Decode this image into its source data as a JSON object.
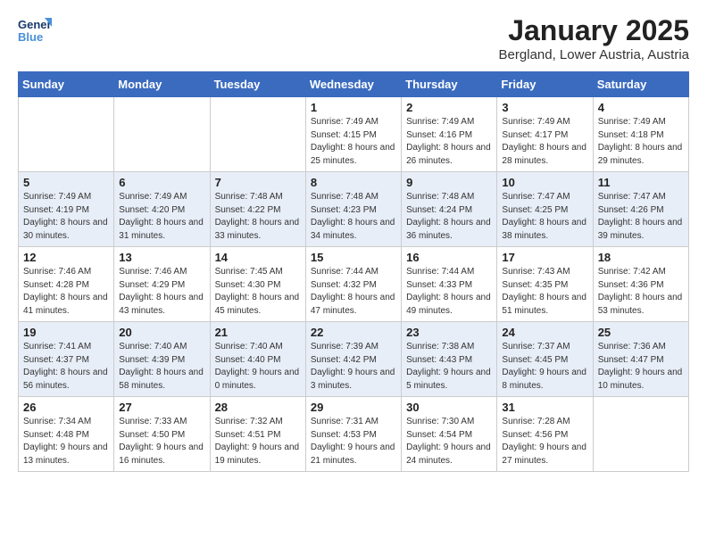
{
  "header": {
    "logo_line1": "General",
    "logo_line2": "Blue",
    "month": "January 2025",
    "location": "Bergland, Lower Austria, Austria"
  },
  "weekdays": [
    "Sunday",
    "Monday",
    "Tuesday",
    "Wednesday",
    "Thursday",
    "Friday",
    "Saturday"
  ],
  "weeks": [
    [
      {
        "day": "",
        "sunrise": "",
        "sunset": "",
        "daylight": ""
      },
      {
        "day": "",
        "sunrise": "",
        "sunset": "",
        "daylight": ""
      },
      {
        "day": "",
        "sunrise": "",
        "sunset": "",
        "daylight": ""
      },
      {
        "day": "1",
        "sunrise": "Sunrise: 7:49 AM",
        "sunset": "Sunset: 4:15 PM",
        "daylight": "Daylight: 8 hours and 25 minutes."
      },
      {
        "day": "2",
        "sunrise": "Sunrise: 7:49 AM",
        "sunset": "Sunset: 4:16 PM",
        "daylight": "Daylight: 8 hours and 26 minutes."
      },
      {
        "day": "3",
        "sunrise": "Sunrise: 7:49 AM",
        "sunset": "Sunset: 4:17 PM",
        "daylight": "Daylight: 8 hours and 28 minutes."
      },
      {
        "day": "4",
        "sunrise": "Sunrise: 7:49 AM",
        "sunset": "Sunset: 4:18 PM",
        "daylight": "Daylight: 8 hours and 29 minutes."
      }
    ],
    [
      {
        "day": "5",
        "sunrise": "Sunrise: 7:49 AM",
        "sunset": "Sunset: 4:19 PM",
        "daylight": "Daylight: 8 hours and 30 minutes."
      },
      {
        "day": "6",
        "sunrise": "Sunrise: 7:49 AM",
        "sunset": "Sunset: 4:20 PM",
        "daylight": "Daylight: 8 hours and 31 minutes."
      },
      {
        "day": "7",
        "sunrise": "Sunrise: 7:48 AM",
        "sunset": "Sunset: 4:22 PM",
        "daylight": "Daylight: 8 hours and 33 minutes."
      },
      {
        "day": "8",
        "sunrise": "Sunrise: 7:48 AM",
        "sunset": "Sunset: 4:23 PM",
        "daylight": "Daylight: 8 hours and 34 minutes."
      },
      {
        "day": "9",
        "sunrise": "Sunrise: 7:48 AM",
        "sunset": "Sunset: 4:24 PM",
        "daylight": "Daylight: 8 hours and 36 minutes."
      },
      {
        "day": "10",
        "sunrise": "Sunrise: 7:47 AM",
        "sunset": "Sunset: 4:25 PM",
        "daylight": "Daylight: 8 hours and 38 minutes."
      },
      {
        "day": "11",
        "sunrise": "Sunrise: 7:47 AM",
        "sunset": "Sunset: 4:26 PM",
        "daylight": "Daylight: 8 hours and 39 minutes."
      }
    ],
    [
      {
        "day": "12",
        "sunrise": "Sunrise: 7:46 AM",
        "sunset": "Sunset: 4:28 PM",
        "daylight": "Daylight: 8 hours and 41 minutes."
      },
      {
        "day": "13",
        "sunrise": "Sunrise: 7:46 AM",
        "sunset": "Sunset: 4:29 PM",
        "daylight": "Daylight: 8 hours and 43 minutes."
      },
      {
        "day": "14",
        "sunrise": "Sunrise: 7:45 AM",
        "sunset": "Sunset: 4:30 PM",
        "daylight": "Daylight: 8 hours and 45 minutes."
      },
      {
        "day": "15",
        "sunrise": "Sunrise: 7:44 AM",
        "sunset": "Sunset: 4:32 PM",
        "daylight": "Daylight: 8 hours and 47 minutes."
      },
      {
        "day": "16",
        "sunrise": "Sunrise: 7:44 AM",
        "sunset": "Sunset: 4:33 PM",
        "daylight": "Daylight: 8 hours and 49 minutes."
      },
      {
        "day": "17",
        "sunrise": "Sunrise: 7:43 AM",
        "sunset": "Sunset: 4:35 PM",
        "daylight": "Daylight: 8 hours and 51 minutes."
      },
      {
        "day": "18",
        "sunrise": "Sunrise: 7:42 AM",
        "sunset": "Sunset: 4:36 PM",
        "daylight": "Daylight: 8 hours and 53 minutes."
      }
    ],
    [
      {
        "day": "19",
        "sunrise": "Sunrise: 7:41 AM",
        "sunset": "Sunset: 4:37 PM",
        "daylight": "Daylight: 8 hours and 56 minutes."
      },
      {
        "day": "20",
        "sunrise": "Sunrise: 7:40 AM",
        "sunset": "Sunset: 4:39 PM",
        "daylight": "Daylight: 8 hours and 58 minutes."
      },
      {
        "day": "21",
        "sunrise": "Sunrise: 7:40 AM",
        "sunset": "Sunset: 4:40 PM",
        "daylight": "Daylight: 9 hours and 0 minutes."
      },
      {
        "day": "22",
        "sunrise": "Sunrise: 7:39 AM",
        "sunset": "Sunset: 4:42 PM",
        "daylight": "Daylight: 9 hours and 3 minutes."
      },
      {
        "day": "23",
        "sunrise": "Sunrise: 7:38 AM",
        "sunset": "Sunset: 4:43 PM",
        "daylight": "Daylight: 9 hours and 5 minutes."
      },
      {
        "day": "24",
        "sunrise": "Sunrise: 7:37 AM",
        "sunset": "Sunset: 4:45 PM",
        "daylight": "Daylight: 9 hours and 8 minutes."
      },
      {
        "day": "25",
        "sunrise": "Sunrise: 7:36 AM",
        "sunset": "Sunset: 4:47 PM",
        "daylight": "Daylight: 9 hours and 10 minutes."
      }
    ],
    [
      {
        "day": "26",
        "sunrise": "Sunrise: 7:34 AM",
        "sunset": "Sunset: 4:48 PM",
        "daylight": "Daylight: 9 hours and 13 minutes."
      },
      {
        "day": "27",
        "sunrise": "Sunrise: 7:33 AM",
        "sunset": "Sunset: 4:50 PM",
        "daylight": "Daylight: 9 hours and 16 minutes."
      },
      {
        "day": "28",
        "sunrise": "Sunrise: 7:32 AM",
        "sunset": "Sunset: 4:51 PM",
        "daylight": "Daylight: 9 hours and 19 minutes."
      },
      {
        "day": "29",
        "sunrise": "Sunrise: 7:31 AM",
        "sunset": "Sunset: 4:53 PM",
        "daylight": "Daylight: 9 hours and 21 minutes."
      },
      {
        "day": "30",
        "sunrise": "Sunrise: 7:30 AM",
        "sunset": "Sunset: 4:54 PM",
        "daylight": "Daylight: 9 hours and 24 minutes."
      },
      {
        "day": "31",
        "sunrise": "Sunrise: 7:28 AM",
        "sunset": "Sunset: 4:56 PM",
        "daylight": "Daylight: 9 hours and 27 minutes."
      },
      {
        "day": "",
        "sunrise": "",
        "sunset": "",
        "daylight": ""
      }
    ]
  ]
}
